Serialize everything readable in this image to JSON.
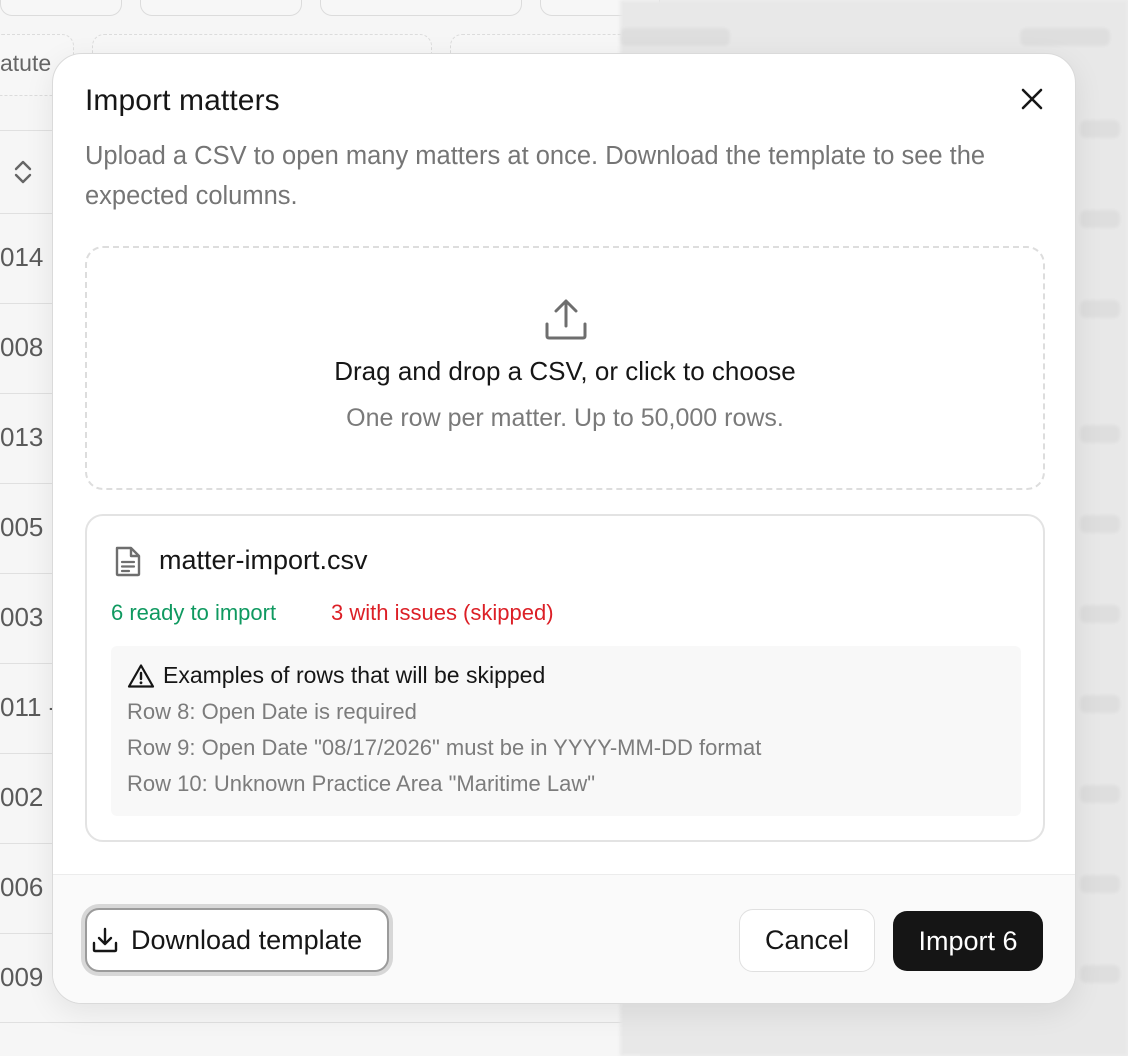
{
  "background": {
    "header_label": "atute",
    "rows": [
      "014",
      "008",
      "013",
      "005",
      "003",
      "011 -",
      "002",
      "006",
      "009"
    ]
  },
  "dialog": {
    "title": "Import matters",
    "description": "Upload a CSV to open many matters at once. Download the template to see the expected columns.",
    "dropzone": {
      "title": "Drag and drop a CSV, or click to choose",
      "subtitle": "One row per matter. Up to 50,000 rows."
    },
    "file": {
      "name": "matter-import.csv",
      "ready_text": "6 ready to import",
      "issues_text": "3 with issues (skipped)",
      "issues_title": "Examples of rows that will be skipped",
      "issues": [
        "Row 8: Open Date is required",
        "Row 9: Open Date \"08/17/2026\" must be in YYYY-MM-DD format",
        "Row 10: Unknown Practice Area \"Maritime Law\""
      ]
    },
    "footer": {
      "download_label": "Download template",
      "cancel_label": "Cancel",
      "import_label": "Import 6"
    }
  },
  "colors": {
    "success": "#0f9960",
    "danger": "#dc1f26",
    "primary": "#151515"
  }
}
